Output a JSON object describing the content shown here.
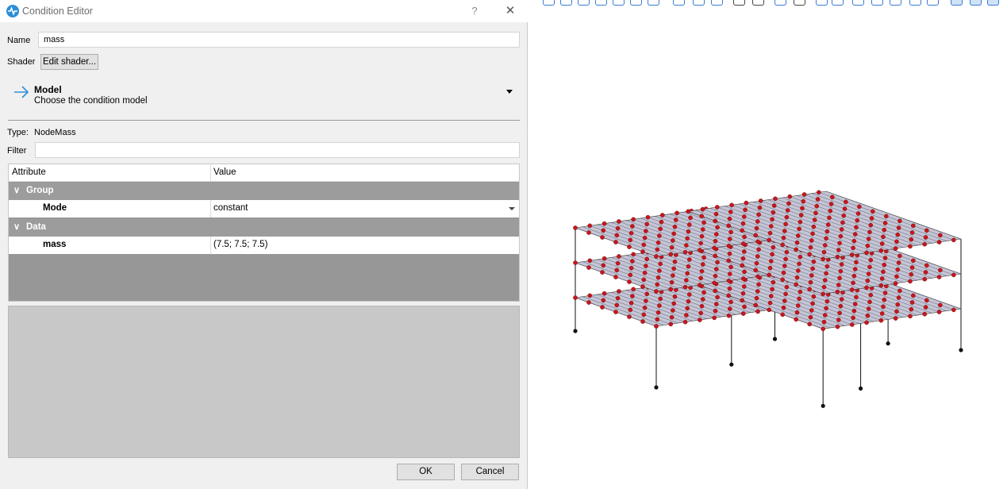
{
  "window": {
    "title": "Condition Editor",
    "help_label": "?",
    "close_label": "✕"
  },
  "form": {
    "name_label": "Name",
    "name_value": "mass",
    "shader_label": "Shader",
    "edit_shader_label": "Edit shader..."
  },
  "model": {
    "title": "Model",
    "subtitle": "Choose the condition model"
  },
  "type": {
    "label": "Type:",
    "value": "NodeMass"
  },
  "filter": {
    "label": "Filter",
    "value": ""
  },
  "table": {
    "col_attribute": "Attribute",
    "col_value": "Value",
    "groups": [
      {
        "name": "Group",
        "rows": [
          {
            "attribute": "Mode",
            "value": "constant"
          }
        ]
      },
      {
        "name": "Data",
        "rows": [
          {
            "attribute": "mass",
            "value": "(7.5; 7.5; 7.5)"
          }
        ]
      }
    ]
  },
  "buttons": {
    "ok": "OK",
    "cancel": "Cancel"
  },
  "colors": {
    "accent": "#2d8fd5",
    "node_red": "#c8161e",
    "slab": "#c4c6d6",
    "support": "#111111"
  },
  "toolbar_icons": [
    "view-iso-icon",
    "view-front-icon",
    "view-back-icon",
    "view-left-icon",
    "view-right-icon",
    "view-top-icon",
    "view-bottom-icon",
    "select-icon",
    "rotate-icon",
    "pan-icon",
    "perspective-icon",
    "lock-icon",
    "zoom-fit-icon",
    "zoom-icon",
    "grid-icon",
    "plane-icon",
    "axes-icon",
    "wireframe-icon",
    "section-icon",
    "snap-icon",
    "render-a-icon",
    "render-b-icon",
    "render-c-icon",
    "render-d-icon"
  ]
}
